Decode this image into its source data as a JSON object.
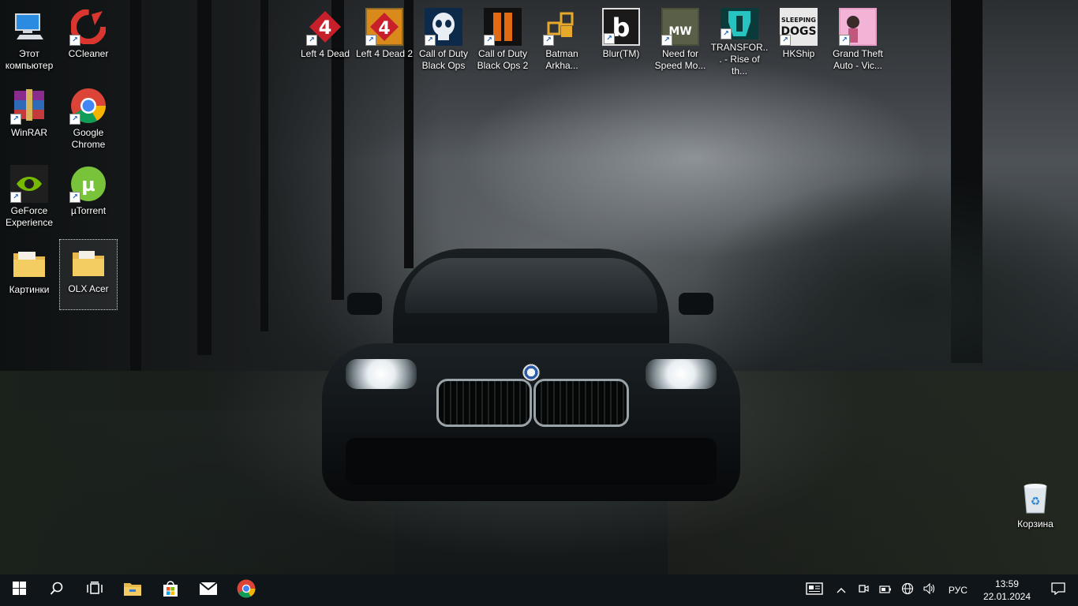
{
  "desktop": {
    "icons": [
      {
        "label": "Этот компьютер",
        "icon": "computer-icon"
      },
      {
        "label": "CCleaner",
        "icon": "ccleaner-icon"
      },
      {
        "label": "Left 4 Dead",
        "icon": "left4dead-icon"
      },
      {
        "label": "Left 4 Dead 2",
        "icon": "left4dead2-icon"
      },
      {
        "label": "Call of Duty Black Ops",
        "icon": "blackops-icon"
      },
      {
        "label": "Call of Duty Black Ops 2",
        "icon": "blackops2-icon"
      },
      {
        "label": "Batman Arkha...",
        "icon": "batman-icon"
      },
      {
        "label": "Blur(TM)",
        "icon": "blur-icon"
      },
      {
        "label": "Need for Speed Mo...",
        "icon": "nfs-mw-icon"
      },
      {
        "label": "TRANSFOR... - Rise of th...",
        "icon": "transformers-icon"
      },
      {
        "label": "HKShip",
        "icon": "sleeping-dogs-icon"
      },
      {
        "label": "Grand Theft Auto - Vic...",
        "icon": "gta-vc-icon"
      },
      {
        "label": "WinRAR",
        "icon": "winrar-icon"
      },
      {
        "label": "Google Chrome",
        "icon": "chrome-icon"
      },
      {
        "label": "GeForce Experience",
        "icon": "geforce-icon"
      },
      {
        "label": "µTorrent",
        "icon": "utorrent-icon"
      },
      {
        "label": "Картинки",
        "icon": "folder-icon"
      },
      {
        "label": "OLX Acer",
        "icon": "folder-icon"
      },
      {
        "label": "Корзина",
        "icon": "recycle-bin-icon"
      }
    ],
    "badges": {
      "l4d": "4",
      "l4d2": "4",
      "nfs": "MW",
      "hkship_top": "SLEEPING",
      "hkship_bottom": "DOGS",
      "blur": "b"
    }
  },
  "taskbar": {
    "items": [
      "start-icon",
      "search-icon",
      "task-view-icon",
      "file-explorer-icon",
      "store-icon",
      "mail-icon",
      "chrome-icon"
    ],
    "tray": {
      "language": "РУС",
      "time": "13:59",
      "date": "22.01.2024"
    }
  },
  "colors": {
    "taskbar": "#101519",
    "label_text": "#ffffff"
  }
}
